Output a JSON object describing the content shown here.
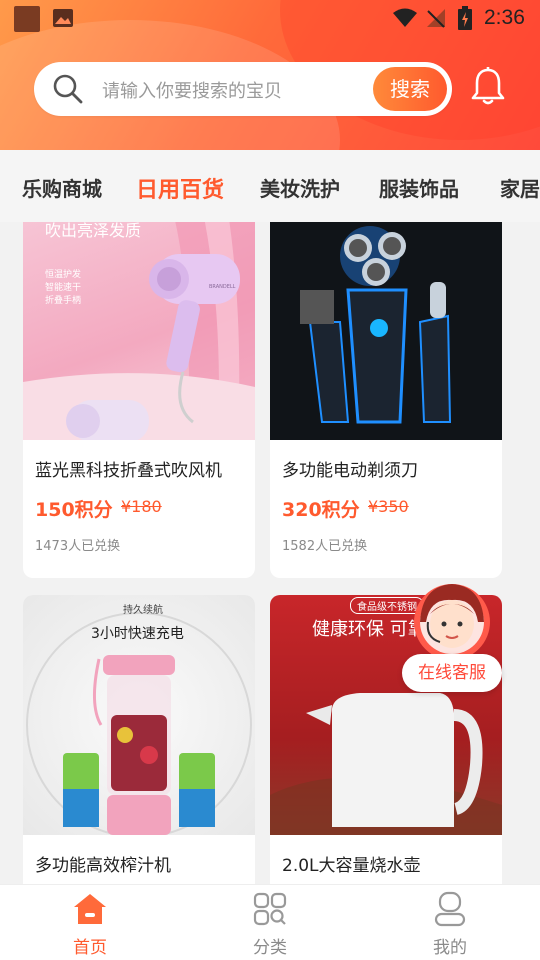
{
  "status_bar": {
    "time": "2:36"
  },
  "search": {
    "placeholder": "请输入你要搜索的宝贝",
    "button": "搜索"
  },
  "tabs": [
    "乐购商城",
    "日用百货",
    "美妆洗护",
    "服装饰品",
    "家居"
  ],
  "active_tab": "日用百货",
  "products": [
    {
      "title": "蓝光黑科技折叠式吹风机",
      "price": "150积分",
      "original": "¥180",
      "sold": "1473人已兑换",
      "image_text": "吹出亮泽发质",
      "image_lines": [
        "恒温护发",
        "智能速干",
        "折叠手柄"
      ],
      "brand": "BRANDELL"
    },
    {
      "title": "多功能电动剃须刀",
      "price": "320积分",
      "original": "¥350",
      "sold": "1582人已兑换"
    },
    {
      "title": "多功能高效榨汁机",
      "image_top": "持久续航",
      "image_text": "3小时快速充电"
    },
    {
      "title": "2.0L大容量烧水壶",
      "image_badge": "食品级不锈钢",
      "image_text": "健康环保 可靠"
    }
  ],
  "service": {
    "label": "在线客服"
  },
  "nav": [
    {
      "label": "首页",
      "icon": "home-icon",
      "active": true
    },
    {
      "label": "分类",
      "icon": "category-icon",
      "active": false
    },
    {
      "label": "我的",
      "icon": "profile-icon",
      "active": false
    }
  ],
  "colors": {
    "accent": "#ff5a2e",
    "header_start": "#ff9a4a",
    "header_end": "#ff4a3a"
  }
}
